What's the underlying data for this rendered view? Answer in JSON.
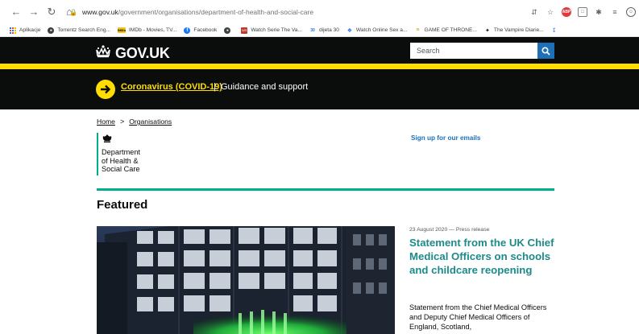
{
  "browser": {
    "url_host": "www.gov.uk",
    "url_path": "/government/organisations/department-of-health-and-social-care",
    "bookmarks": [
      {
        "label": "Aplikacje",
        "icon": "apps-grid-icon"
      },
      {
        "label": "Torrentz Search Eng...",
        "icon": "globe-icon"
      },
      {
        "label": "IMDb - Movies, TV...",
        "icon": "imdb-icon",
        "badge": "IMDb"
      },
      {
        "label": "Facebook",
        "icon": "facebook-icon",
        "badge": "f"
      },
      {
        "label": "",
        "icon": "globe-icon"
      },
      {
        "label": "Watch Serie The Va...",
        "icon": "watch-series-icon",
        "badge": "WS"
      },
      {
        "label": "dijeta 30",
        "icon": "dijeta-icon",
        "badge": "30"
      },
      {
        "label": "Watch Online Sex a...",
        "icon": "bird-icon"
      },
      {
        "label": "GAME OF THRONE...",
        "icon": "got-icon"
      },
      {
        "label": "The Vampire Diarie...",
        "icon": "vampire-icon"
      }
    ]
  },
  "header": {
    "logo_text": "GOV.UK",
    "search_placeholder": "Search"
  },
  "covid": {
    "link": "Coronavirus (COVID-19)",
    "separator": "|",
    "text": "Guidance and support"
  },
  "breadcrumb": {
    "home": "Home",
    "separator": ">",
    "organisations": "Organisations"
  },
  "organisation": {
    "name": "Department\nof Health &\nSocial Care"
  },
  "signup": "Sign up for our emails",
  "featured": {
    "heading": "Featured",
    "meta": "23 August 2020 — Press release",
    "title": "Statement from the UK Chief Medical Officers on schools and childcare reopening",
    "description": "Statement from the Chief Medical Officers and Deputy Chief Medical Officers of England, Scotland,"
  },
  "colors": {
    "gov_black": "#0b0c0c",
    "gov_yellow": "#ffdd00",
    "gov_blue": "#1d70b8",
    "dhsc_teal": "#00ad93",
    "title_teal": "#1d8a8a"
  }
}
